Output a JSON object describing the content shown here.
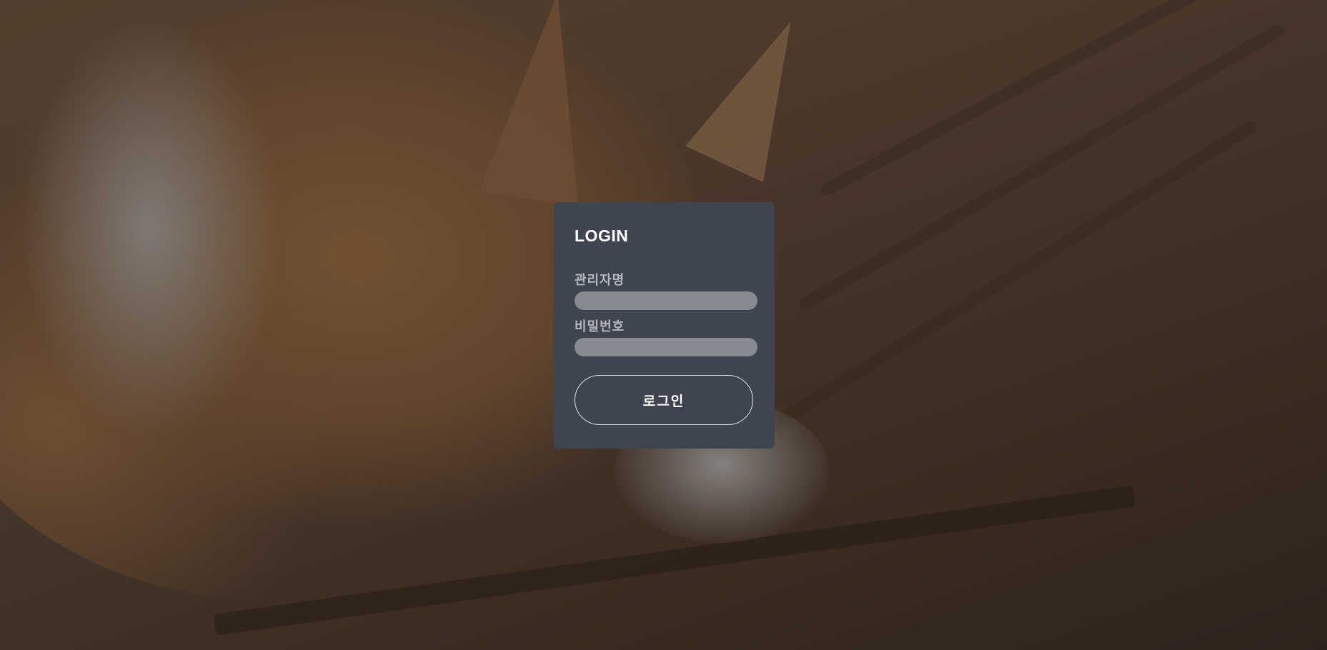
{
  "background": {
    "description_icon": "sleeping-cat-photo"
  },
  "login": {
    "title": "LOGIN",
    "admin_label": "관리자명",
    "admin_value": "",
    "password_label": "비밀번호",
    "password_value": "",
    "submit_label": "로그인"
  },
  "colors": {
    "card_bg": "#3f4550",
    "input_bg": "#868b92",
    "label_text": "#b4b8be",
    "title_text": "#ffffff",
    "button_border": "#dcdfe3"
  }
}
